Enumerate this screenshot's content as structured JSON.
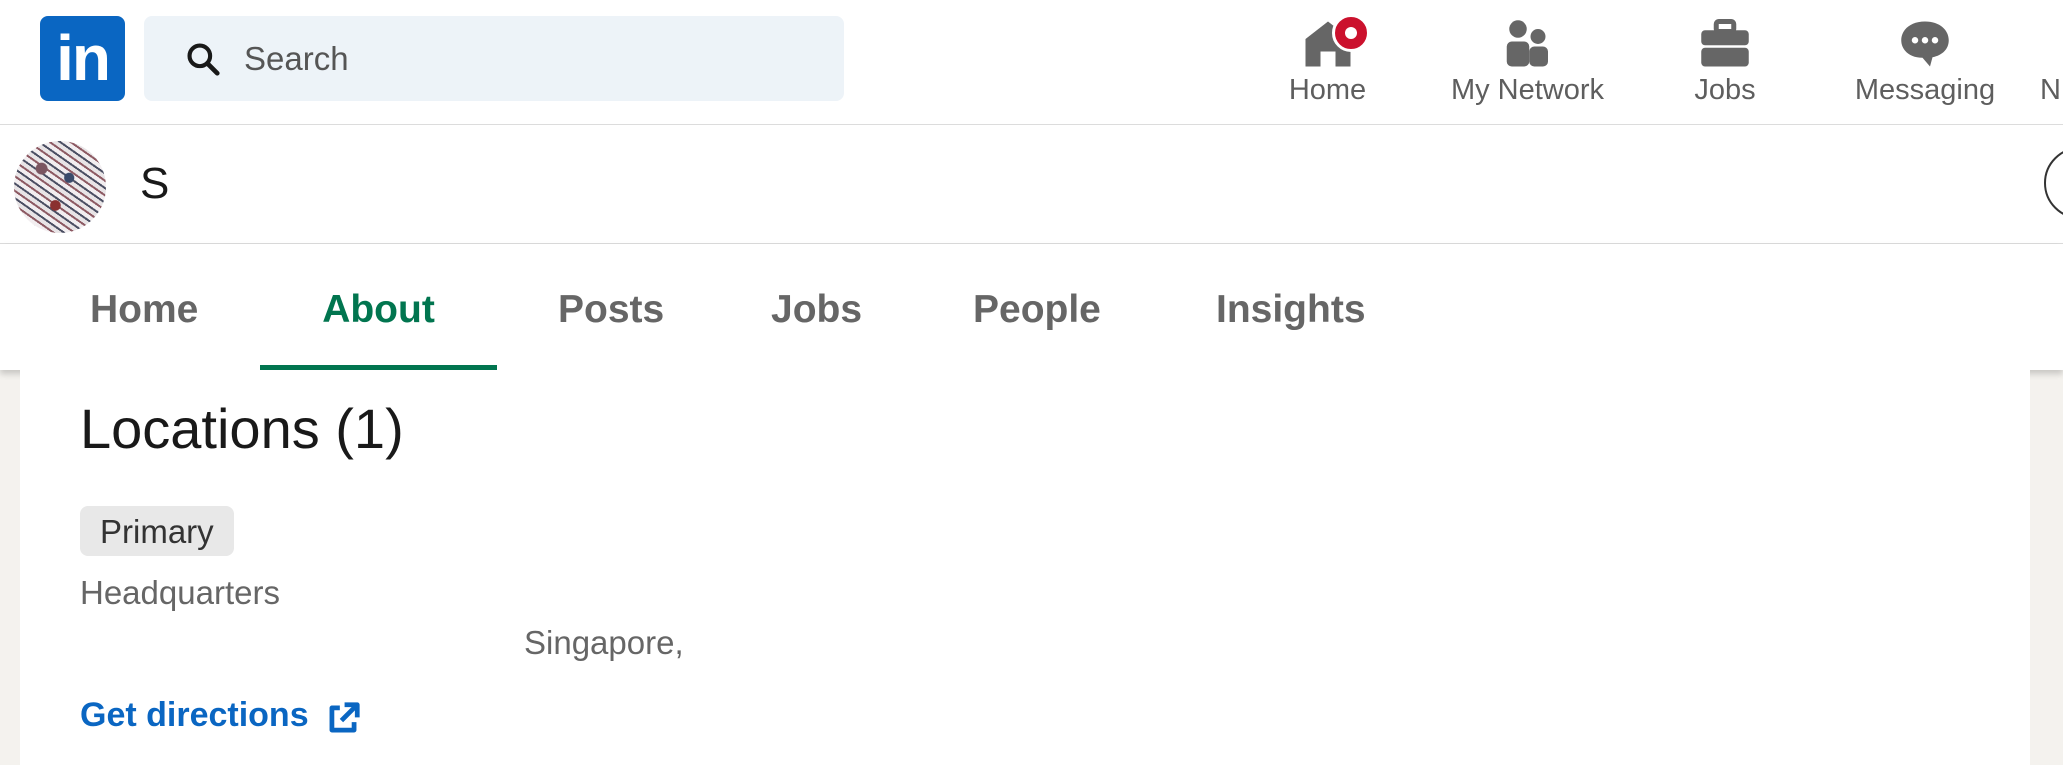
{
  "nav": {
    "logo_text": "in",
    "search_placeholder": "Search",
    "items": [
      {
        "label": "Home",
        "icon": "home-icon"
      },
      {
        "label": "My Network",
        "icon": "network-icon"
      },
      {
        "label": "Jobs",
        "icon": "briefcase-icon"
      },
      {
        "label": "Messaging",
        "icon": "messaging-icon"
      },
      {
        "label": "N",
        "icon": "notifications-icon"
      }
    ]
  },
  "org": {
    "name": "S"
  },
  "tabs": [
    {
      "label": "Home",
      "active": false
    },
    {
      "label": "About",
      "active": true
    },
    {
      "label": "Posts",
      "active": false
    },
    {
      "label": "Jobs",
      "active": false
    },
    {
      "label": "People",
      "active": false
    },
    {
      "label": "Insights",
      "active": false
    }
  ],
  "locations": {
    "title": "Locations (1)",
    "entries": [
      {
        "badge": "Primary",
        "label": "Headquarters",
        "address": "Singapore,",
        "directions_label": "Get directions"
      }
    ]
  },
  "colors": {
    "brand": "#0a66c2",
    "active_tab": "#01754f",
    "notification_badge": "#cb112d"
  }
}
